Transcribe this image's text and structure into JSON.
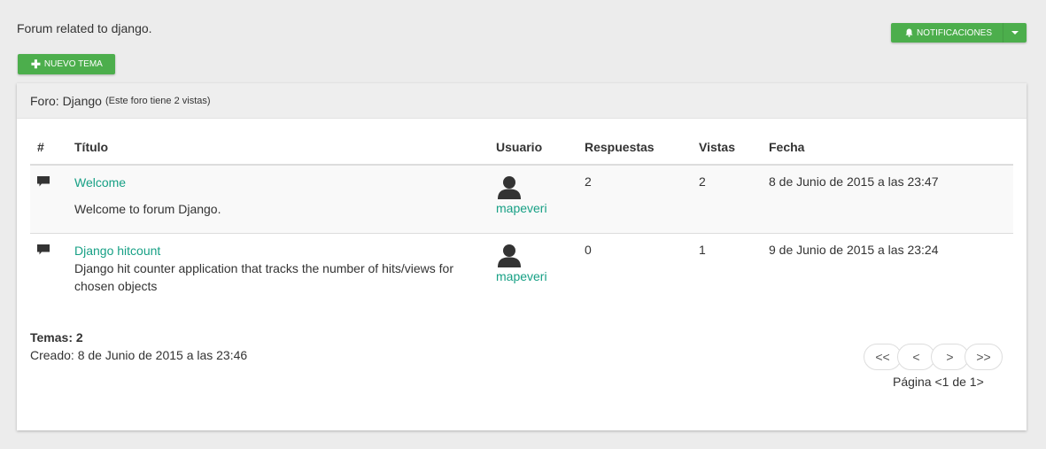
{
  "forum_description": "Forum related to django.",
  "buttons": {
    "new_topic": "NUEVO TEMA",
    "notifications": "NOTIFICACIONES"
  },
  "panel": {
    "title": "Foro: Django",
    "views_note": "(Este foro tiene 2 vistas)"
  },
  "table": {
    "headers": [
      "#",
      "Título",
      "Usuario",
      "Respuestas",
      "Vistas",
      "Fecha"
    ],
    "rows": [
      {
        "title": "Welcome",
        "description": "Welcome to forum Django.",
        "user": "mapeveri",
        "replies": "2",
        "views": "2",
        "date": "8 de Junio de 2015 a las 23:47"
      },
      {
        "title": "Django hitcount",
        "description": "Django hit counter application that tracks the number of hits/views for chosen objects",
        "user": "mapeveri",
        "replies": "0",
        "views": "1",
        "date": "9 de Junio de 2015 a las 23:24"
      }
    ]
  },
  "stats": {
    "topics": "Temas: 2",
    "created": "Creado: 8 de Junio de 2015 a las 23:46"
  },
  "pagination": {
    "first": "<<",
    "prev": "<",
    "next": ">",
    "last": ">>",
    "label": "Página <1 de 1>"
  },
  "icons": {
    "topic": "comment-icon",
    "user": "user-avatar-icon",
    "notifications": "bell-icon",
    "new_topic": "plus-icon"
  },
  "colors": {
    "accent_green": "#4cae4c",
    "link": "#17a085"
  }
}
